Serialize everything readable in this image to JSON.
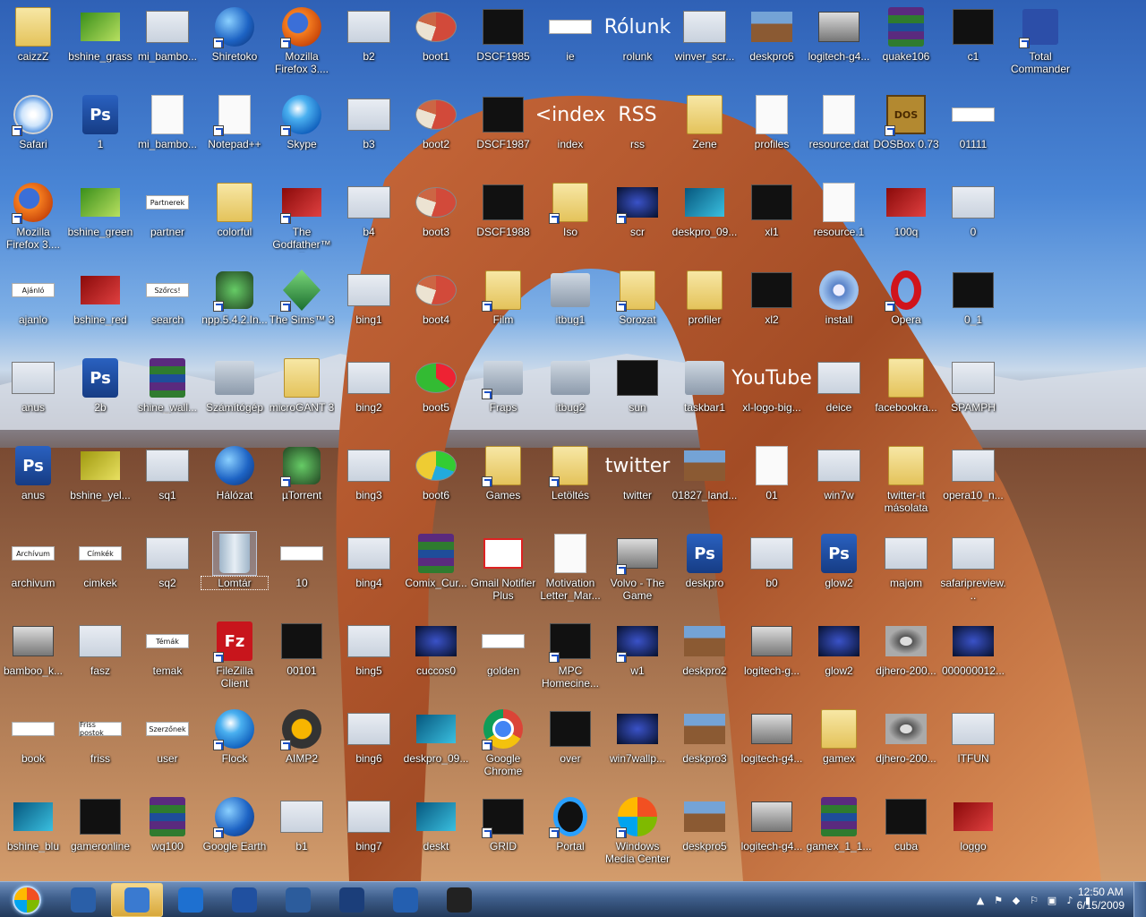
{
  "desktop": {
    "icons": [
      {
        "label": "caizzZ",
        "style": "t-folder",
        "col": 0,
        "row": 0
      },
      {
        "label": "bshine_grass",
        "style": "t-green",
        "col": 1,
        "row": 0
      },
      {
        "label": "mi_bambo...",
        "style": "t-shot",
        "col": 2,
        "row": 0
      },
      {
        "label": "Shiretoko",
        "style": "t-globe",
        "col": 3,
        "row": 0,
        "shortcut": true
      },
      {
        "label": "Mozilla Firefox 3....",
        "style": "t-fox",
        "col": 4,
        "row": 0,
        "shortcut": true
      },
      {
        "label": "b2",
        "style": "t-shot",
        "col": 5,
        "row": 0
      },
      {
        "label": "boot1",
        "style": "t-pie",
        "col": 6,
        "row": 0
      },
      {
        "label": "DSCF1985",
        "style": "t-dark",
        "col": 7,
        "row": 0
      },
      {
        "label": "ie",
        "style": "t-text",
        "col": 8,
        "row": 0
      },
      {
        "label": "rolunk",
        "style": "t-rss",
        "col": 9,
        "row": 0,
        "glyph": "Rólunk"
      },
      {
        "label": "winver_scr...",
        "style": "t-shot",
        "col": 10,
        "row": 0
      },
      {
        "label": "deskpro6",
        "style": "t-land",
        "col": 11,
        "row": 0
      },
      {
        "label": "logitech-g4...",
        "style": "t-gcar",
        "col": 12,
        "row": 0
      },
      {
        "label": "quake106",
        "style": "t-rar",
        "col": 13,
        "row": 0
      },
      {
        "label": "c1",
        "style": "t-dark",
        "col": 14,
        "row": 0
      },
      {
        "label": "Total Commander",
        "style": "t-floppy",
        "col": 15,
        "row": 0,
        "shortcut": true
      },
      {
        "label": "Safari",
        "style": "t-safari",
        "col": 0,
        "row": 1,
        "shortcut": true
      },
      {
        "label": "1",
        "style": "t-ps",
        "col": 1,
        "row": 1,
        "glyph": "Ps"
      },
      {
        "label": "mi_bambo...",
        "style": "t-white",
        "col": 2,
        "row": 1
      },
      {
        "label": "Notepad++",
        "style": "t-white",
        "col": 3,
        "row": 1,
        "shortcut": true
      },
      {
        "label": "Skype",
        "style": "t-orb",
        "col": 4,
        "row": 1,
        "shortcut": true
      },
      {
        "label": "b3",
        "style": "t-shot",
        "col": 5,
        "row": 1
      },
      {
        "label": "boot2",
        "style": "t-pie",
        "col": 6,
        "row": 1
      },
      {
        "label": "DSCF1987",
        "style": "t-dark",
        "col": 7,
        "row": 1
      },
      {
        "label": "index",
        "style": "t-rss",
        "col": 8,
        "row": 1,
        "glyph": "<index"
      },
      {
        "label": "rss",
        "style": "t-rss",
        "col": 9,
        "row": 1,
        "glyph": "RSS"
      },
      {
        "label": "Zene",
        "style": "t-folder",
        "col": 10,
        "row": 1
      },
      {
        "label": "profiles",
        "style": "t-white",
        "col": 11,
        "row": 1
      },
      {
        "label": "resource.dat",
        "style": "t-white",
        "col": 12,
        "row": 1
      },
      {
        "label": "DOSBox 0.73",
        "style": "t-dos",
        "col": 13,
        "row": 1,
        "glyph": "DOS",
        "shortcut": true
      },
      {
        "label": "01111",
        "style": "t-text",
        "col": 14,
        "row": 1
      },
      {
        "label": "Mozilla Firefox 3....",
        "style": "t-fox",
        "col": 0,
        "row": 2,
        "shortcut": true
      },
      {
        "label": "bshine_green",
        "style": "t-green",
        "col": 1,
        "row": 2
      },
      {
        "label": "partner",
        "style": "t-text",
        "col": 2,
        "row": 2,
        "glyph": "Partnerek"
      },
      {
        "label": "colorful",
        "style": "t-folder",
        "col": 3,
        "row": 2
      },
      {
        "label": "The Godfather™ II",
        "style": "t-red",
        "col": 4,
        "row": 2,
        "shortcut": true
      },
      {
        "label": "b4",
        "style": "t-shot",
        "col": 5,
        "row": 2
      },
      {
        "label": "boot3",
        "style": "t-pie",
        "col": 6,
        "row": 2
      },
      {
        "label": "DSCF1988",
        "style": "t-dark",
        "col": 7,
        "row": 2
      },
      {
        "label": "Iso",
        "style": "t-folder",
        "col": 8,
        "row": 2,
        "shortcut": true
      },
      {
        "label": "scr",
        "style": "t-night",
        "col": 9,
        "row": 2,
        "shortcut": true
      },
      {
        "label": "deskpro_09...",
        "style": "t-cyan",
        "col": 10,
        "row": 2
      },
      {
        "label": "xl1",
        "style": "t-dark",
        "col": 11,
        "row": 2
      },
      {
        "label": "resource.1",
        "style": "t-white",
        "col": 12,
        "row": 2
      },
      {
        "label": "100q",
        "style": "t-red",
        "col": 13,
        "row": 2
      },
      {
        "label": "0",
        "style": "t-shot",
        "col": 14,
        "row": 2
      },
      {
        "label": "ajanlo",
        "style": "t-text",
        "col": 0,
        "row": 3,
        "glyph": "Ajánló"
      },
      {
        "label": "bshine_red",
        "style": "t-red",
        "col": 1,
        "row": 3
      },
      {
        "label": "search",
        "style": "t-text",
        "col": 2,
        "row": 3,
        "glyph": "Szőrcs!"
      },
      {
        "label": "npp.5.4.2.In...",
        "style": "t-green2",
        "col": 3,
        "row": 3,
        "shortcut": true
      },
      {
        "label": "The Sims™ 3",
        "style": "t-sims",
        "col": 4,
        "row": 3,
        "shortcut": true
      },
      {
        "label": "bing1",
        "style": "t-shot",
        "col": 5,
        "row": 3
      },
      {
        "label": "boot4",
        "style": "t-pie",
        "col": 6,
        "row": 3
      },
      {
        "label": "Film",
        "style": "t-folder",
        "col": 7,
        "row": 3,
        "shortcut": true
      },
      {
        "label": "itbug1",
        "style": "t-gray",
        "col": 8,
        "row": 3
      },
      {
        "label": "Sorozat",
        "style": "t-folder",
        "col": 9,
        "row": 3,
        "shortcut": true
      },
      {
        "label": "profiler",
        "style": "t-folder",
        "col": 10,
        "row": 3
      },
      {
        "label": "xl2",
        "style": "t-dark",
        "col": 11,
        "row": 3
      },
      {
        "label": "install",
        "style": "t-gear",
        "col": 12,
        "row": 3
      },
      {
        "label": "Opera",
        "style": "t-opera",
        "col": 13,
        "row": 3,
        "shortcut": true
      },
      {
        "label": "0_1",
        "style": "t-dark",
        "col": 14,
        "row": 3
      },
      {
        "label": "anus",
        "style": "t-shot",
        "col": 0,
        "row": 4
      },
      {
        "label": "2b",
        "style": "t-ps",
        "col": 1,
        "row": 4,
        "glyph": "Ps"
      },
      {
        "label": "shine_wall...",
        "style": "t-rar",
        "col": 2,
        "row": 4
      },
      {
        "label": "Számítógép",
        "style": "t-gray",
        "col": 3,
        "row": 4
      },
      {
        "label": "microGANT 3",
        "style": "t-folder",
        "col": 4,
        "row": 4
      },
      {
        "label": "bing2",
        "style": "t-shot",
        "col": 5,
        "row": 4
      },
      {
        "label": "boot5",
        "style": "t-pie2",
        "col": 6,
        "row": 4
      },
      {
        "label": "Fraps",
        "style": "t-gray",
        "col": 7,
        "row": 4,
        "shortcut": true
      },
      {
        "label": "itbug2",
        "style": "t-gray",
        "col": 8,
        "row": 4
      },
      {
        "label": "sun",
        "style": "t-dark",
        "col": 9,
        "row": 4
      },
      {
        "label": "taskbar1",
        "style": "t-gray",
        "col": 10,
        "row": 4
      },
      {
        "label": "xl-logo-big...",
        "style": "t-rss",
        "col": 11,
        "row": 4,
        "glyph": "YouTube"
      },
      {
        "label": "deice",
        "style": "t-shot",
        "col": 12,
        "row": 4
      },
      {
        "label": "facebookra...",
        "style": "t-folder",
        "col": 13,
        "row": 4
      },
      {
        "label": "SPAMPH",
        "style": "t-shot",
        "col": 14,
        "row": 4
      },
      {
        "label": "anus",
        "style": "t-ps",
        "col": 0,
        "row": 5,
        "glyph": "Ps"
      },
      {
        "label": "bshine_yel...",
        "style": "t-yel",
        "col": 1,
        "row": 5
      },
      {
        "label": "sq1",
        "style": "t-shot",
        "col": 2,
        "row": 5
      },
      {
        "label": "Hálózat",
        "style": "t-globe",
        "col": 3,
        "row": 5
      },
      {
        "label": "µTorrent",
        "style": "t-green2",
        "col": 4,
        "row": 5,
        "shortcut": true
      },
      {
        "label": "bing3",
        "style": "t-shot",
        "col": 5,
        "row": 5
      },
      {
        "label": "boot6",
        "style": "t-pie3",
        "col": 6,
        "row": 5
      },
      {
        "label": "Games",
        "style": "t-folder",
        "col": 7,
        "row": 5,
        "shortcut": true
      },
      {
        "label": "Letöltés",
        "style": "t-folder",
        "col": 8,
        "row": 5,
        "shortcut": true
      },
      {
        "label": "twitter",
        "style": "t-rss",
        "col": 9,
        "row": 5,
        "glyph": "twitter"
      },
      {
        "label": "01827_land...",
        "style": "t-land",
        "col": 10,
        "row": 5
      },
      {
        "label": "01",
        "style": "t-white",
        "col": 11,
        "row": 5
      },
      {
        "label": "win7w",
        "style": "t-shot",
        "col": 12,
        "row": 5
      },
      {
        "label": "twitter-it másolata",
        "style": "t-folder",
        "col": 13,
        "row": 5
      },
      {
        "label": "opera10_n...",
        "style": "t-shot",
        "col": 14,
        "row": 5
      },
      {
        "label": "archivum",
        "style": "t-text",
        "col": 0,
        "row": 6,
        "glyph": "Archívum"
      },
      {
        "label": "cimkek",
        "style": "t-text",
        "col": 1,
        "row": 6,
        "glyph": "Címkék"
      },
      {
        "label": "sq2",
        "style": "t-shot",
        "col": 2,
        "row": 6
      },
      {
        "label": "Lomtár",
        "style": "t-bin",
        "col": 3,
        "row": 6,
        "selected": true
      },
      {
        "label": "10",
        "style": "t-text",
        "col": 4,
        "row": 6
      },
      {
        "label": "bing4",
        "style": "t-shot",
        "col": 5,
        "row": 6
      },
      {
        "label": "Comix_Cur...",
        "style": "t-rar",
        "col": 6,
        "row": 6
      },
      {
        "label": "Gmail Notifier Plus",
        "style": "t-mail",
        "col": 7,
        "row": 6
      },
      {
        "label": "Motivation Letter_Mar...",
        "style": "t-white",
        "col": 8,
        "row": 6
      },
      {
        "label": "Volvo - The Game",
        "style": "t-gcar",
        "col": 9,
        "row": 6,
        "shortcut": true
      },
      {
        "label": "deskpro",
        "style": "t-ps",
        "col": 10,
        "row": 6,
        "glyph": "Ps"
      },
      {
        "label": "b0",
        "style": "t-shot",
        "col": 11,
        "row": 6
      },
      {
        "label": "glow2",
        "style": "t-ps",
        "col": 12,
        "row": 6,
        "glyph": "Ps"
      },
      {
        "label": "majom",
        "style": "t-shot",
        "col": 13,
        "row": 6
      },
      {
        "label": "safaripreview...",
        "style": "t-shot",
        "col": 14,
        "row": 6
      },
      {
        "label": "bamboo_k...",
        "style": "t-gcar",
        "col": 0,
        "row": 7
      },
      {
        "label": "fasz",
        "style": "t-shot",
        "col": 1,
        "row": 7
      },
      {
        "label": "temak",
        "style": "t-text",
        "col": 2,
        "row": 7,
        "glyph": "Témák"
      },
      {
        "label": "FileZilla Client",
        "style": "t-fz",
        "col": 3,
        "row": 7,
        "glyph": "Fz",
        "shortcut": true
      },
      {
        "label": "00101",
        "style": "t-dark",
        "col": 4,
        "row": 7
      },
      {
        "label": "bing5",
        "style": "t-shot",
        "col": 5,
        "row": 7
      },
      {
        "label": "cuccos0",
        "style": "t-night",
        "col": 6,
        "row": 7
      },
      {
        "label": "golden",
        "style": "t-text",
        "col": 7,
        "row": 7
      },
      {
        "label": "MPC Homecine...",
        "style": "t-dark",
        "col": 8,
        "row": 7,
        "shortcut": true
      },
      {
        "label": "w1",
        "style": "t-night",
        "col": 9,
        "row": 7,
        "shortcut": true
      },
      {
        "label": "deskpro2",
        "style": "t-land",
        "col": 10,
        "row": 7
      },
      {
        "label": "logitech-g...",
        "style": "t-gcar",
        "col": 11,
        "row": 7
      },
      {
        "label": "glow2",
        "style": "t-night",
        "col": 12,
        "row": 7
      },
      {
        "label": "djhero-200...",
        "style": "t-cd",
        "col": 13,
        "row": 7
      },
      {
        "label": "000000012...",
        "style": "t-night",
        "col": 14,
        "row": 7
      },
      {
        "label": "book",
        "style": "t-text",
        "col": 0,
        "row": 8
      },
      {
        "label": "friss",
        "style": "t-text",
        "col": 1,
        "row": 8,
        "glyph": "Friss postok"
      },
      {
        "label": "user",
        "style": "t-text",
        "col": 2,
        "row": 8,
        "glyph": "Szerzőnek"
      },
      {
        "label": "Flock",
        "style": "t-orb",
        "col": 3,
        "row": 8,
        "shortcut": true
      },
      {
        "label": "AIMP2",
        "style": "t-aimp",
        "col": 4,
        "row": 8,
        "shortcut": true
      },
      {
        "label": "bing6",
        "style": "t-shot",
        "col": 5,
        "row": 8
      },
      {
        "label": "deskpro_09...",
        "style": "t-cyan",
        "col": 6,
        "row": 8
      },
      {
        "label": "Google Chrome",
        "style": "t-chrome",
        "col": 7,
        "row": 8,
        "shortcut": true
      },
      {
        "label": "over",
        "style": "t-dark",
        "col": 8,
        "row": 8
      },
      {
        "label": "win7wallp...",
        "style": "t-night",
        "col": 9,
        "row": 8
      },
      {
        "label": "deskpro3",
        "style": "t-land",
        "col": 10,
        "row": 8
      },
      {
        "label": "logitech-g4...",
        "style": "t-gcar",
        "col": 11,
        "row": 8
      },
      {
        "label": "gamex",
        "style": "t-folder",
        "col": 12,
        "row": 8
      },
      {
        "label": "djhero-200...",
        "style": "t-cd",
        "col": 13,
        "row": 8
      },
      {
        "label": "ITFUN",
        "style": "t-shot",
        "col": 14,
        "row": 8
      },
      {
        "label": "bshine_blu",
        "style": "t-cyan",
        "col": 0,
        "row": 9
      },
      {
        "label": "gameronline",
        "style": "t-dark",
        "col": 1,
        "row": 9
      },
      {
        "label": "wq100",
        "style": "t-rar",
        "col": 2,
        "row": 9
      },
      {
        "label": "Google Earth",
        "style": "t-globe",
        "col": 3,
        "row": 9,
        "shortcut": true
      },
      {
        "label": "b1",
        "style": "t-shot",
        "col": 4,
        "row": 9
      },
      {
        "label": "bing7",
        "style": "t-shot",
        "col": 5,
        "row": 9
      },
      {
        "label": "deskt",
        "style": "t-cyan",
        "col": 6,
        "row": 9
      },
      {
        "label": "GRID",
        "style": "t-dark",
        "col": 7,
        "row": 9,
        "shortcut": true
      },
      {
        "label": "Portal",
        "style": "t-portal",
        "col": 8,
        "row": 9,
        "shortcut": true
      },
      {
        "label": "Windows Media Center",
        "style": "t-win",
        "col": 9,
        "row": 9,
        "shortcut": true
      },
      {
        "label": "deskpro5",
        "style": "t-land",
        "col": 10,
        "row": 9
      },
      {
        "label": "logitech-g4...",
        "style": "t-gcar",
        "col": 11,
        "row": 9
      },
      {
        "label": "gamex_1_1...",
        "style": "t-rar",
        "col": 12,
        "row": 9
      },
      {
        "label": "cuba",
        "style": "t-dark",
        "col": 13,
        "row": 9
      },
      {
        "label": "loggo",
        "style": "t-red",
        "col": 14,
        "row": 9
      }
    ]
  },
  "taskbar": {
    "start_label": "Start",
    "buttons": [
      {
        "name": "tb-button-desktop",
        "color": "#2a5fa8",
        "active": false
      },
      {
        "name": "tb-button-messenger",
        "color": "#3a7ad0",
        "active": true
      },
      {
        "name": "tb-button-internet-explorer",
        "color": "#1e70d0",
        "active": false
      },
      {
        "name": "tb-button-winamp",
        "color": "#2050a0",
        "active": false
      },
      {
        "name": "tb-button-media-player",
        "color": "#2c5c9c",
        "active": false
      },
      {
        "name": "tb-button-screen",
        "color": "#1b3e7a",
        "active": false
      },
      {
        "name": "tb-button-utorrent",
        "color": "#245fb0",
        "active": false
      },
      {
        "name": "tb-button-music-player",
        "color": "#222222",
        "active": false
      }
    ],
    "tray_icons": [
      "▲",
      "⚑",
      "◆",
      "⚐",
      "▣",
      "♪",
      "▮"
    ],
    "clock_time": "12:50 AM",
    "clock_date": "6/15/2009"
  }
}
